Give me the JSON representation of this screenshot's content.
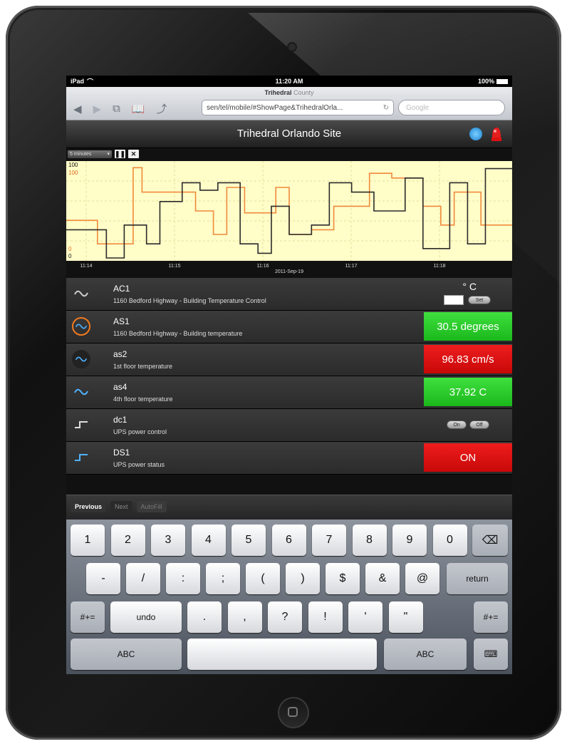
{
  "statusbar": {
    "device": "iPad",
    "time": "11:20 AM",
    "battery": "100%"
  },
  "browser": {
    "title": "Trihedral",
    "title_sub": "County",
    "url": "sen/tel/mobile/#ShowPage&TrihedralOrla...",
    "search_placeholder": "Google"
  },
  "app": {
    "title": "Trihedral Orlando Site"
  },
  "chart_toolbar": {
    "interval": "5 minutes"
  },
  "chart_data": {
    "type": "line",
    "xlabel": "2011-Sep-19",
    "x_ticks": [
      "11:14",
      "11:15",
      "11:16",
      "11:17",
      "11:18"
    ],
    "y_ticks_left_dark": [
      "100",
      "0"
    ],
    "y_ticks_left_orange": [
      "100",
      "0"
    ],
    "ylim": [
      0,
      100
    ],
    "grid": true,
    "series": [
      {
        "color": "#f08a3c",
        "x": [
          0,
          0.07,
          0.11,
          0.15,
          0.17,
          0.29,
          0.33,
          0.36,
          0.4,
          0.47,
          0.5,
          0.55,
          0.6,
          0.68,
          0.73,
          0.8,
          0.84,
          0.87,
          0.93,
          0.97,
          1.0
        ],
        "y": [
          40,
          15,
          15,
          96,
          70,
          50,
          25,
          75,
          48,
          75,
          25,
          30,
          55,
          90,
          85,
          55,
          35,
          70,
          35,
          35,
          35
        ]
      },
      {
        "color": "#2b2b2b",
        "x": [
          0,
          0.05,
          0.09,
          0.13,
          0.18,
          0.21,
          0.26,
          0.3,
          0.34,
          0.39,
          0.43,
          0.46,
          0.5,
          0.55,
          0.59,
          0.64,
          0.69,
          0.76,
          0.8,
          0.86,
          0.9,
          0.94,
          1.0
        ],
        "y": [
          30,
          30,
          0,
          35,
          15,
          60,
          80,
          72,
          80,
          15,
          5,
          55,
          25,
          35,
          80,
          70,
          50,
          85,
          10,
          80,
          15,
          95,
          95
        ]
      }
    ]
  },
  "rows": [
    {
      "name": "AC1",
      "desc": "1160 Bedford Highway - Building Temperature Control",
      "unit": "° C",
      "set_label": "Set"
    },
    {
      "name": "AS1",
      "desc": "1160 Bedford Highway - Building temperature",
      "value": "30.5 degrees",
      "status_color": "#22c322"
    },
    {
      "name": "as2",
      "desc": "1st floor temperature",
      "value": "96.83 cm/s",
      "status_color": "#d40f0f"
    },
    {
      "name": "as4",
      "desc": "4th floor temperature",
      "value": "37.92 C",
      "status_color": "#22c322"
    },
    {
      "name": "dc1",
      "desc": "UPS power control",
      "on_label": "On",
      "off_label": "Off"
    },
    {
      "name": "DS1",
      "desc": "UPS power status",
      "value": "ON",
      "status_color": "#d40f0f"
    }
  ],
  "keyboard_toolbar": {
    "previous": "Previous",
    "next": "Next",
    "autofill": "AutoFill"
  },
  "keyboard": {
    "row1": [
      "1",
      "2",
      "3",
      "4",
      "5",
      "6",
      "7",
      "8",
      "9",
      "0"
    ],
    "row2": [
      "-",
      "/",
      ":",
      ";",
      "(",
      ")",
      "$",
      "&",
      "@"
    ],
    "row3": [
      ".",
      ",",
      "?",
      "!",
      "'",
      "\""
    ],
    "shift_label": "#+=",
    "undo_label": "undo",
    "return_label": "return",
    "abc_label": "ABC"
  }
}
